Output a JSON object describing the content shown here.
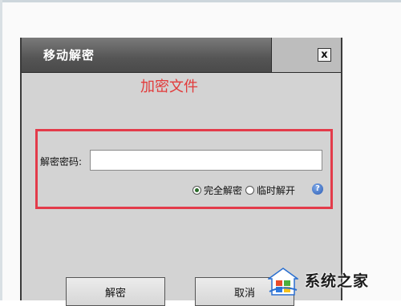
{
  "dialog": {
    "title": "移动解密",
    "close_label": "x",
    "annotation": "加密文件",
    "password_label": "解密密码:",
    "password_value": "",
    "radio_options": [
      {
        "label": "完全解密",
        "checked": true
      },
      {
        "label": "临时解开",
        "checked": false
      }
    ],
    "help_label": "?",
    "buttons": {
      "decrypt": "解密",
      "cancel": "取消"
    }
  },
  "watermark": {
    "text": "系统之家",
    "icon": "windows-house-logo"
  },
  "colors": {
    "annotation_red": "#e33b4a",
    "titlebar": "#555555",
    "dialog_bg": "#d3d3d3",
    "help_blue": "#2c5db4"
  }
}
